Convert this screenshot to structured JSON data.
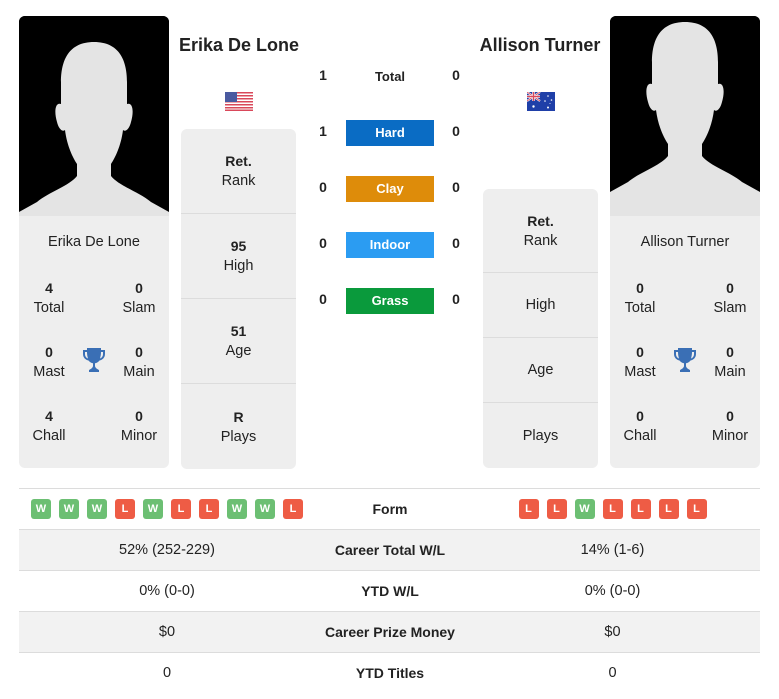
{
  "colors": {
    "hard": "#0a6cc4",
    "clay": "#de8c0a",
    "indoor": "#2b9cf2",
    "grass": "#0a9a3c",
    "win": "#6cbf73",
    "loss": "#ee5c45",
    "trophy": "#3a6fb5"
  },
  "player1": {
    "name": "Erika De Lone",
    "flag": "usa-flag-icon",
    "card_name": "Erika De Lone",
    "titles": {
      "total": {
        "value": "4",
        "label": "Total"
      },
      "slam": {
        "value": "0",
        "label": "Slam"
      },
      "mast": {
        "value": "0",
        "label": "Mast"
      },
      "main": {
        "value": "0",
        "label": "Main"
      },
      "chall": {
        "value": "4",
        "label": "Chall"
      },
      "minor": {
        "value": "0",
        "label": "Minor"
      }
    },
    "rank": {
      "rank": {
        "value": "Ret.",
        "label": "Rank"
      },
      "high": {
        "value": "95",
        "label": "High"
      },
      "age": {
        "value": "51",
        "label": "Age"
      },
      "plays": {
        "value": "R",
        "label": "Plays"
      }
    },
    "form": [
      "W",
      "W",
      "W",
      "L",
      "W",
      "L",
      "L",
      "W",
      "W",
      "L"
    ]
  },
  "player2": {
    "name": "Allison Turner",
    "flag": "australia-flag-icon",
    "card_name": "Allison Turner",
    "titles": {
      "total": {
        "value": "0",
        "label": "Total"
      },
      "slam": {
        "value": "0",
        "label": "Slam"
      },
      "mast": {
        "value": "0",
        "label": "Mast"
      },
      "main": {
        "value": "0",
        "label": "Main"
      },
      "chall": {
        "value": "0",
        "label": "Chall"
      },
      "minor": {
        "value": "0",
        "label": "Minor"
      }
    },
    "rank": {
      "rank": {
        "value": "Ret.",
        "label": "Rank"
      },
      "high": {
        "value": "",
        "label": "High"
      },
      "age": {
        "value": "",
        "label": "Age"
      },
      "plays": {
        "value": "",
        "label": "Plays"
      }
    },
    "form": [
      "L",
      "L",
      "W",
      "L",
      "L",
      "L",
      "L"
    ]
  },
  "h2h": {
    "total": {
      "label": "Total",
      "p1": "1",
      "p2": "0"
    },
    "surfaces": [
      {
        "label": "Hard",
        "p1": "1",
        "p2": "0"
      },
      {
        "label": "Clay",
        "p1": "0",
        "p2": "0"
      },
      {
        "label": "Indoor",
        "p1": "0",
        "p2": "0"
      },
      {
        "label": "Grass",
        "p1": "0",
        "p2": "0"
      }
    ]
  },
  "table": {
    "form_label": "Form",
    "rows": [
      {
        "label": "Career Total W/L",
        "p1": "52% (252-229)",
        "p2": "14% (1-6)"
      },
      {
        "label": "YTD W/L",
        "p1": "0% (0-0)",
        "p2": "0% (0-0)"
      },
      {
        "label": "Career Prize Money",
        "p1": "$0",
        "p2": "$0"
      },
      {
        "label": "YTD Titles",
        "p1": "0",
        "p2": "0"
      }
    ]
  }
}
